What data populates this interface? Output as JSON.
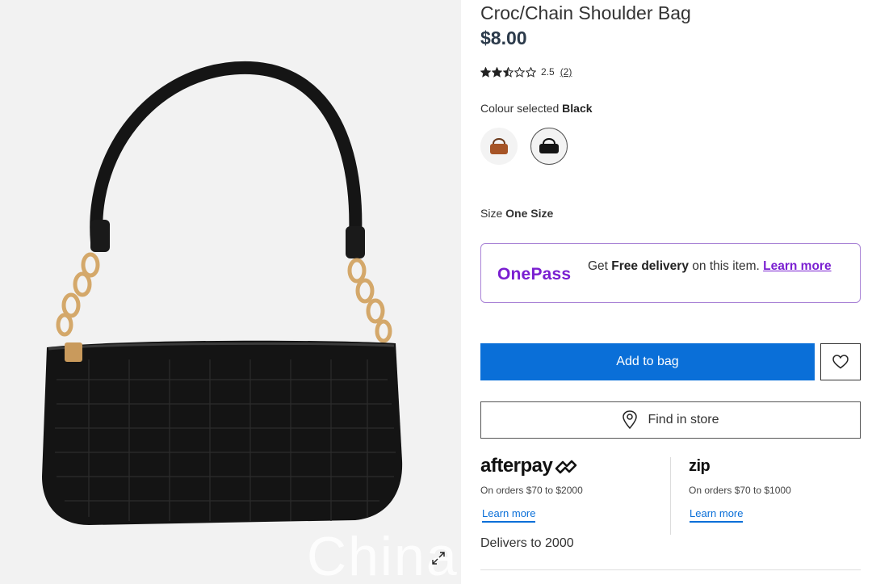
{
  "product": {
    "title": "Croc/Chain Shoulder Bag",
    "price": "$8.00",
    "rating_value": "2.5",
    "rating_count": "(2)",
    "rating_fraction": 0.5
  },
  "colour": {
    "label": "Colour selected",
    "selected": "Black",
    "options": [
      "tan",
      "black"
    ]
  },
  "size": {
    "label": "Size",
    "value": "One Size"
  },
  "onepass": {
    "logo": "OnePass",
    "text_prefix": "Get",
    "text_bold": "Free delivery",
    "text_suffix": "on this item.",
    "link": "Learn more"
  },
  "actions": {
    "add_to_bag": "Add to bag",
    "find_in_store": "Find in store"
  },
  "payments": {
    "afterpay": {
      "logo": "afterpay",
      "note": "On orders $70 to $2000",
      "link": "Learn more"
    },
    "zip": {
      "logo": "zip",
      "note": "On orders $70 to $1000",
      "link": "Learn more"
    }
  },
  "delivery": {
    "text": "Delivers to 2000"
  },
  "watermark": "China",
  "colors": {
    "primary": "#0a6fd8",
    "onepass": "#7a1fd1",
    "price": "#2b3a4a"
  }
}
